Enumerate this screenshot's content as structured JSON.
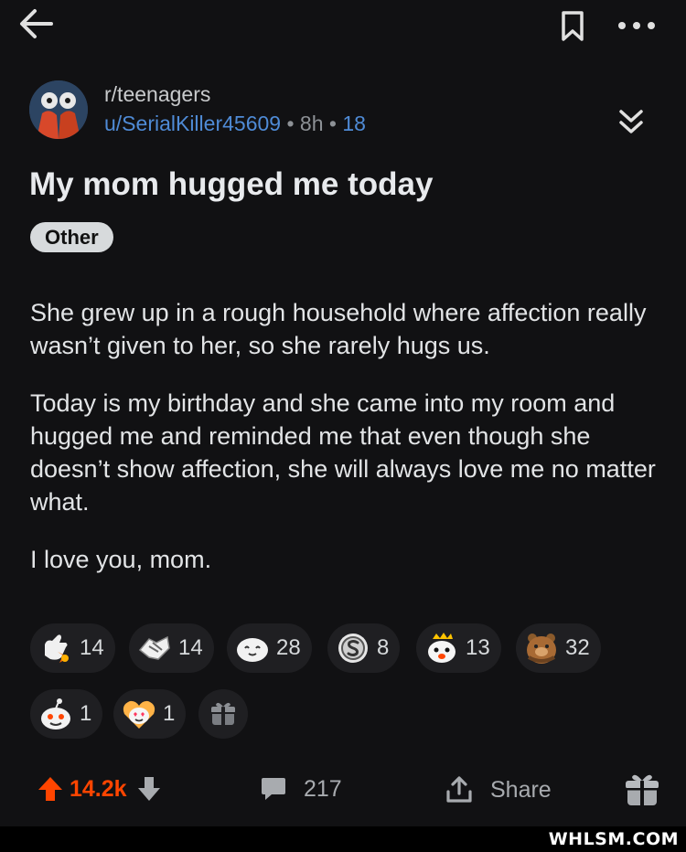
{
  "post": {
    "subreddit": "r/teenagers",
    "author": "u/SerialKiller45609",
    "separator": "•",
    "age": "8h",
    "award_count": "18",
    "title": "My mom hugged me today",
    "flair": "Other",
    "paragraphs": [
      "She grew up in a rough household where affection really wasn’t given to her, so she rarely hugs us.",
      "Today is my birthday and she came into my room and hugged me and reminded me that even though she doesn’t show affection, she will always love me no matter what.",
      "I love you, mom."
    ]
  },
  "awards": [
    {
      "icon": "wholesome-hand-icon",
      "count": "14"
    },
    {
      "icon": "handshake-icon",
      "count": "14"
    },
    {
      "icon": "blush-face-icon",
      "count": "28"
    },
    {
      "icon": "silver-coin-icon",
      "count": "8"
    },
    {
      "icon": "crowned-snoo-icon",
      "count": "13"
    },
    {
      "icon": "bear-hug-icon",
      "count": "32"
    },
    {
      "icon": "snoo-face-icon",
      "count": "1"
    },
    {
      "icon": "heart-eyes-icon",
      "count": "1"
    },
    {
      "icon": "gift-icon",
      "count": ""
    }
  ],
  "footer": {
    "score": "14.2k",
    "comments": "217",
    "share_label": "Share"
  },
  "colors": {
    "upvote": "#ff4500",
    "link": "#4f8bd6",
    "background": "#111113"
  },
  "watermark": "WHLSM.COM"
}
